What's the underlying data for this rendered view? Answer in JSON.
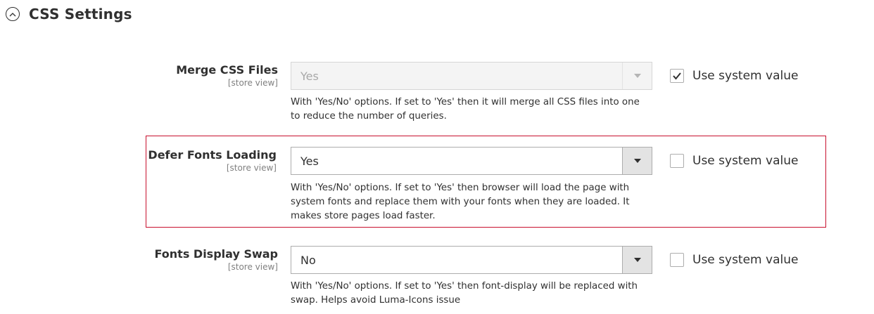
{
  "section": {
    "title": "CSS Settings",
    "expanded": true
  },
  "fields": [
    {
      "label": "Merge CSS Files",
      "scope": "[store view]",
      "value": "Yes",
      "disabled": true,
      "note_lines": [
        "With 'Yes/No' options. If set to 'Yes' then it will merge all CSS files into one",
        "to reduce the number of queries."
      ],
      "use_system_value_label": "Use system value",
      "use_system_value_checked": true
    },
    {
      "label": "Defer Fonts Loading",
      "scope": "[store view]",
      "value": "Yes",
      "disabled": false,
      "note_lines": [
        "With 'Yes/No' options. If set to 'Yes' then browser will load the page with",
        "system fonts and replace them with your fonts when they are loaded. It",
        "makes store pages load faster."
      ],
      "use_system_value_label": "Use system value",
      "use_system_value_checked": false
    },
    {
      "label": "Fonts Display Swap",
      "scope": "[store view]",
      "value": "No",
      "disabled": false,
      "note_lines": [
        "With 'Yes/No' options. If set to 'Yes' then font-display will be replaced with",
        "swap. Helps avoid Luma-Icons issue"
      ],
      "use_system_value_label": "Use system value",
      "use_system_value_checked": false
    }
  ],
  "colors": {
    "highlight_border": "#c8102e",
    "text": "#303030",
    "muted": "#808080"
  }
}
